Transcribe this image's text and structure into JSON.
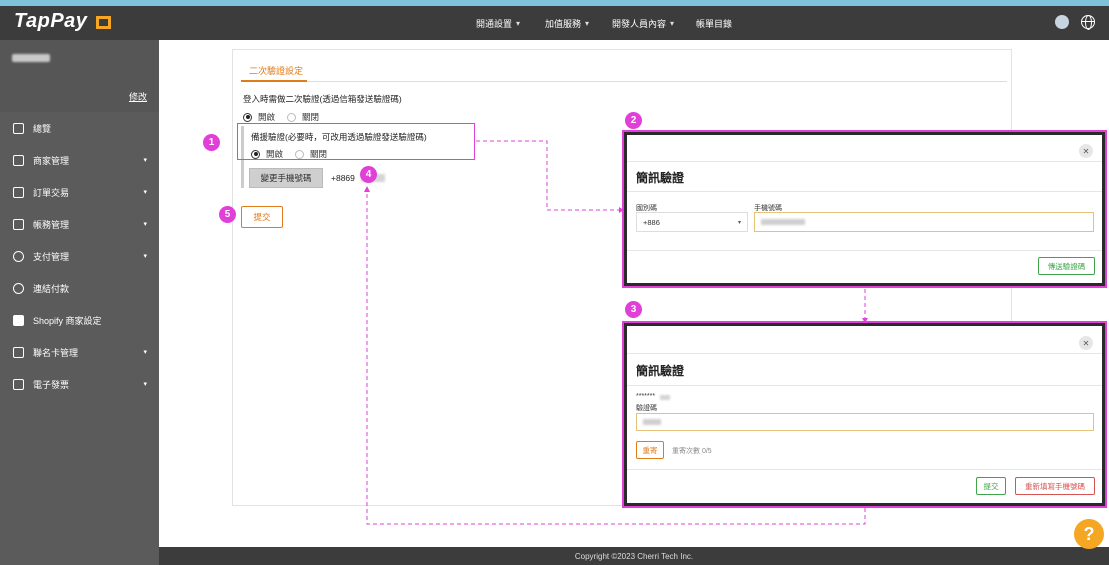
{
  "header": {
    "logo_text": "TapPay",
    "nav": [
      {
        "label": "開通設置",
        "caret": "▾"
      },
      {
        "label": "加值服務",
        "caret": "▾"
      },
      {
        "label": "開發人員內容",
        "caret": "▾"
      },
      {
        "label": "帳單目錄",
        "caret": ""
      }
    ]
  },
  "sidebar": {
    "edit_label": "修改",
    "items": [
      {
        "label": "總覽",
        "icon": "grid-icon"
      },
      {
        "label": "商家管理",
        "icon": "store-icon",
        "caret": "▾"
      },
      {
        "label": "訂單交易",
        "icon": "orders-icon",
        "caret": "▾"
      },
      {
        "label": "帳務管理",
        "icon": "bank-icon",
        "caret": "▾"
      },
      {
        "label": "支付管理",
        "icon": "payment-icon",
        "caret": "▾"
      },
      {
        "label": "連結付款",
        "icon": "link-icon"
      },
      {
        "label": "Shopify 商家設定",
        "icon": "shopify-icon"
      },
      {
        "label": "聯名卡管理",
        "icon": "card-icon",
        "caret": "▾"
      },
      {
        "label": "電子發票",
        "icon": "invoice-icon",
        "caret": "▾"
      }
    ]
  },
  "main": {
    "tab_label": "二次驗證設定",
    "question": "登入時需做二次驗證(透過信箱發送驗證碼)",
    "opt_on": "開啟",
    "opt_off": "關閉",
    "backup_label": "備援驗證(必要時，可改用透過驗證發送驗證碼)",
    "change_phone_button": "變更手機號碼",
    "phone_prefix": "+8869",
    "submit_button": "提交"
  },
  "annotations": [
    "1",
    "2",
    "3",
    "4",
    "5"
  ],
  "modal_sms": {
    "title": "簡訊驗證",
    "country_label": "國別碼",
    "country_value": "+886",
    "phone_label": "手機號碼",
    "send_button": "傳送驗證碼"
  },
  "modal_verify": {
    "title": "簡訊驗證",
    "masked_phone": "*******",
    "code_label": "驗證碼",
    "resend_button": "重寄",
    "resend_count": "重寄次數 0/5",
    "submit_button": "提交",
    "reenter_button": "重新填寫手機號碼"
  },
  "footer": {
    "copyright": "Copyright ©2023 Cherri Tech Inc."
  },
  "help_label": "?",
  "colors": {
    "accent": "#e07b1a",
    "annotation": "#e040d8",
    "success": "#3fa54a",
    "danger": "#d9534f"
  }
}
